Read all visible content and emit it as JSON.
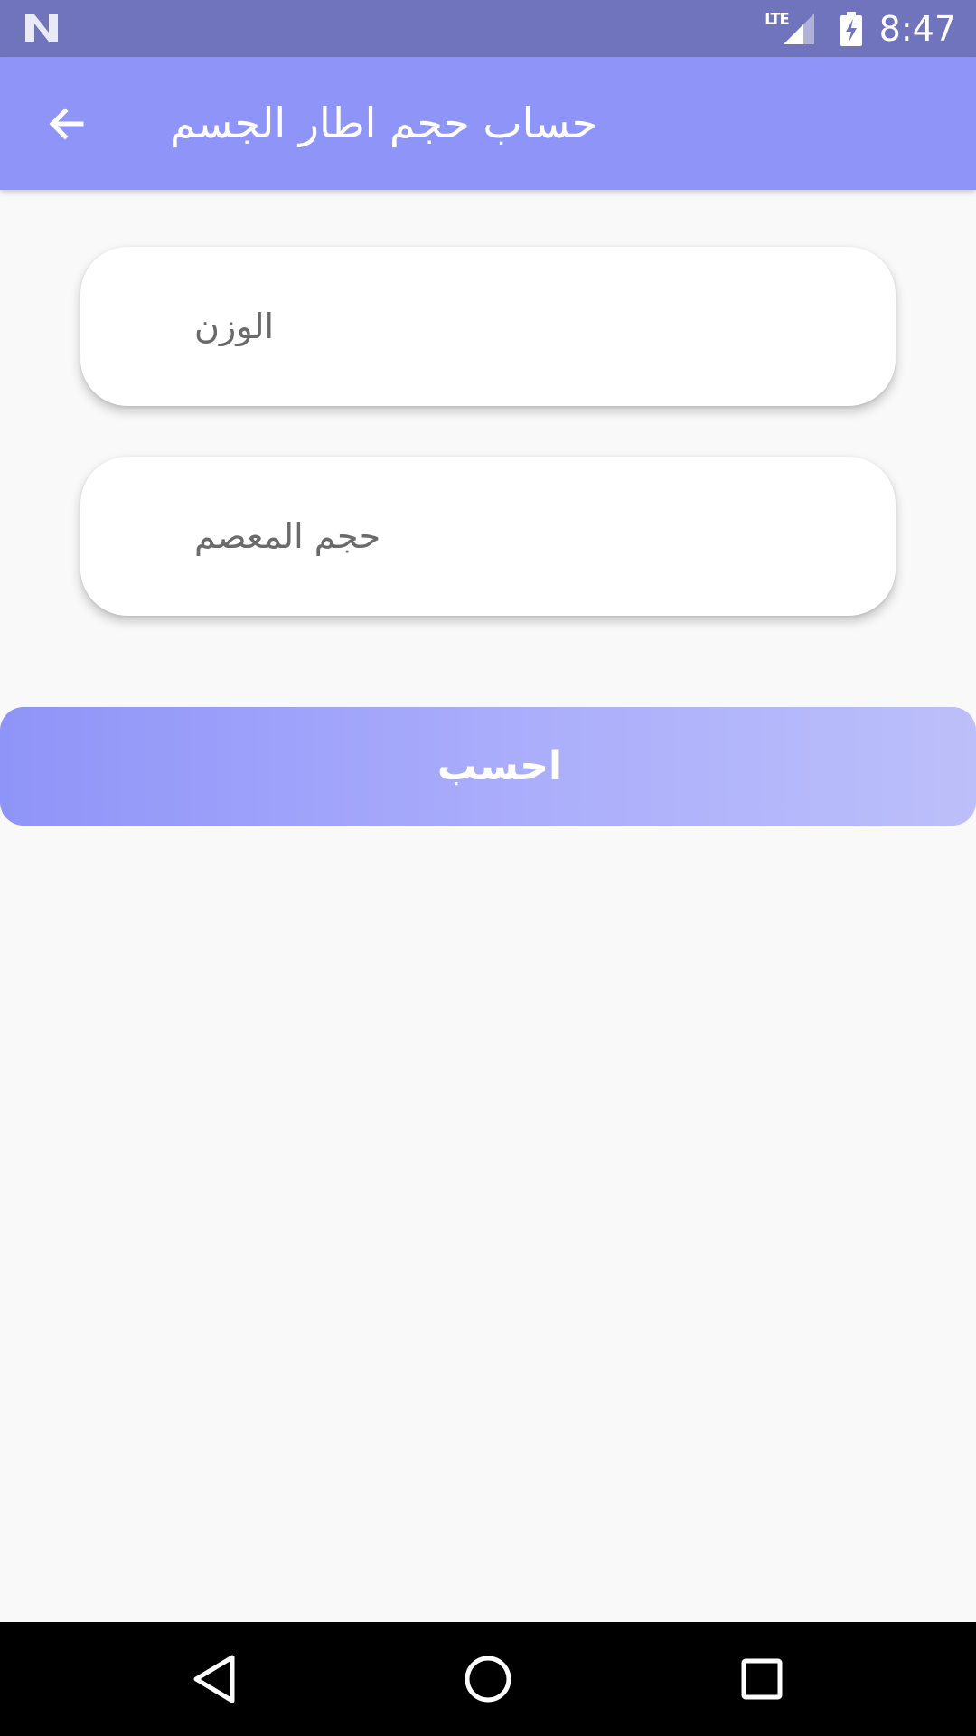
{
  "status_bar": {
    "network_type": "LTE",
    "time": "8:47",
    "left_icon": "notification-n-icon",
    "signal_icon": "signal-icon",
    "battery_icon": "battery-charging-icon"
  },
  "toolbar": {
    "title": "حساب حجم اطار الجسم",
    "back_icon": "arrow-back-icon",
    "background_color": "#8f94f8"
  },
  "form": {
    "weight_placeholder": "الوزن",
    "wrist_placeholder": "حجم المعصم",
    "calculate_label": "احسب"
  },
  "nav_bar": {
    "back_icon": "nav-back-triangle-icon",
    "home_icon": "nav-home-circle-icon",
    "recent_icon": "nav-recent-square-icon"
  },
  "colors": {
    "status_bar": "#6f74bd",
    "accent": "#8f94f8",
    "background": "#f9f9f9"
  }
}
